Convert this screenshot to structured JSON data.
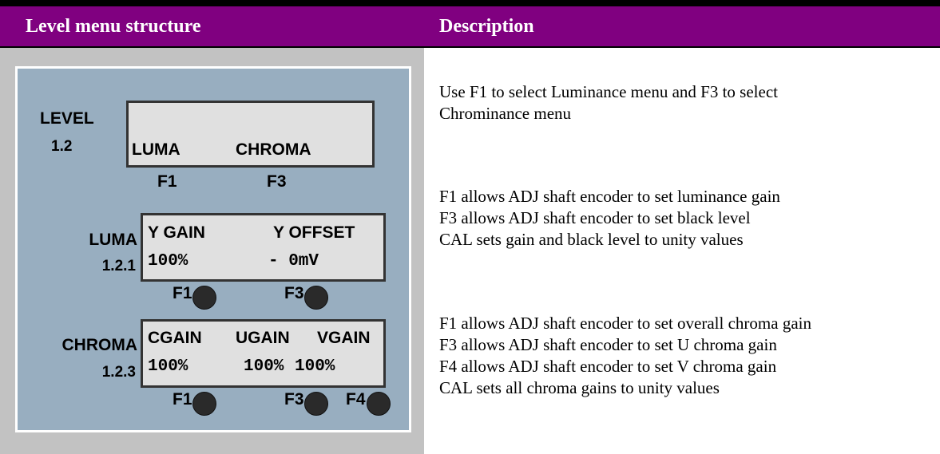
{
  "header": {
    "left_title": "Level menu structure",
    "right_title": "Description",
    "accent_color": "#800080"
  },
  "menus": {
    "level": {
      "name": "LEVEL",
      "number": "1.2",
      "lcd_row2": [
        "LUMA",
        "CHROMA"
      ],
      "keys": [
        "F1",
        "F3"
      ]
    },
    "luma": {
      "name": "LUMA",
      "number": "1.2.1",
      "lcd_row1": [
        "Y GAIN",
        "Y OFFSET"
      ],
      "lcd_row2": [
        "100%",
        "- 0mV"
      ],
      "keys": [
        "F1",
        "F3"
      ]
    },
    "chroma": {
      "name": "CHROMA",
      "number": "1.2.3",
      "lcd_row1": [
        "CGAIN",
        "UGAIN",
        "VGAIN"
      ],
      "lcd_row2": [
        "100%",
        "100%",
        "100%"
      ],
      "keys": [
        "F1",
        "F3",
        "F4"
      ]
    }
  },
  "descriptions": {
    "level": [
      "Use F1 to select Luminance menu and F3 to select",
      "Chrominance menu"
    ],
    "luma": [
      "F1 allows ADJ shaft encoder to set luminance gain",
      "F3 allows ADJ shaft encoder to set black level",
      "CAL sets gain and black level to unity values"
    ],
    "chroma": [
      "F1 allows ADJ shaft encoder to set overall chroma gain",
      "F3 allows ADJ shaft encoder to set U chroma gain",
      "F4 allows ADJ shaft encoder to set V chroma gain",
      "CAL sets all chroma gains to unity values"
    ]
  }
}
